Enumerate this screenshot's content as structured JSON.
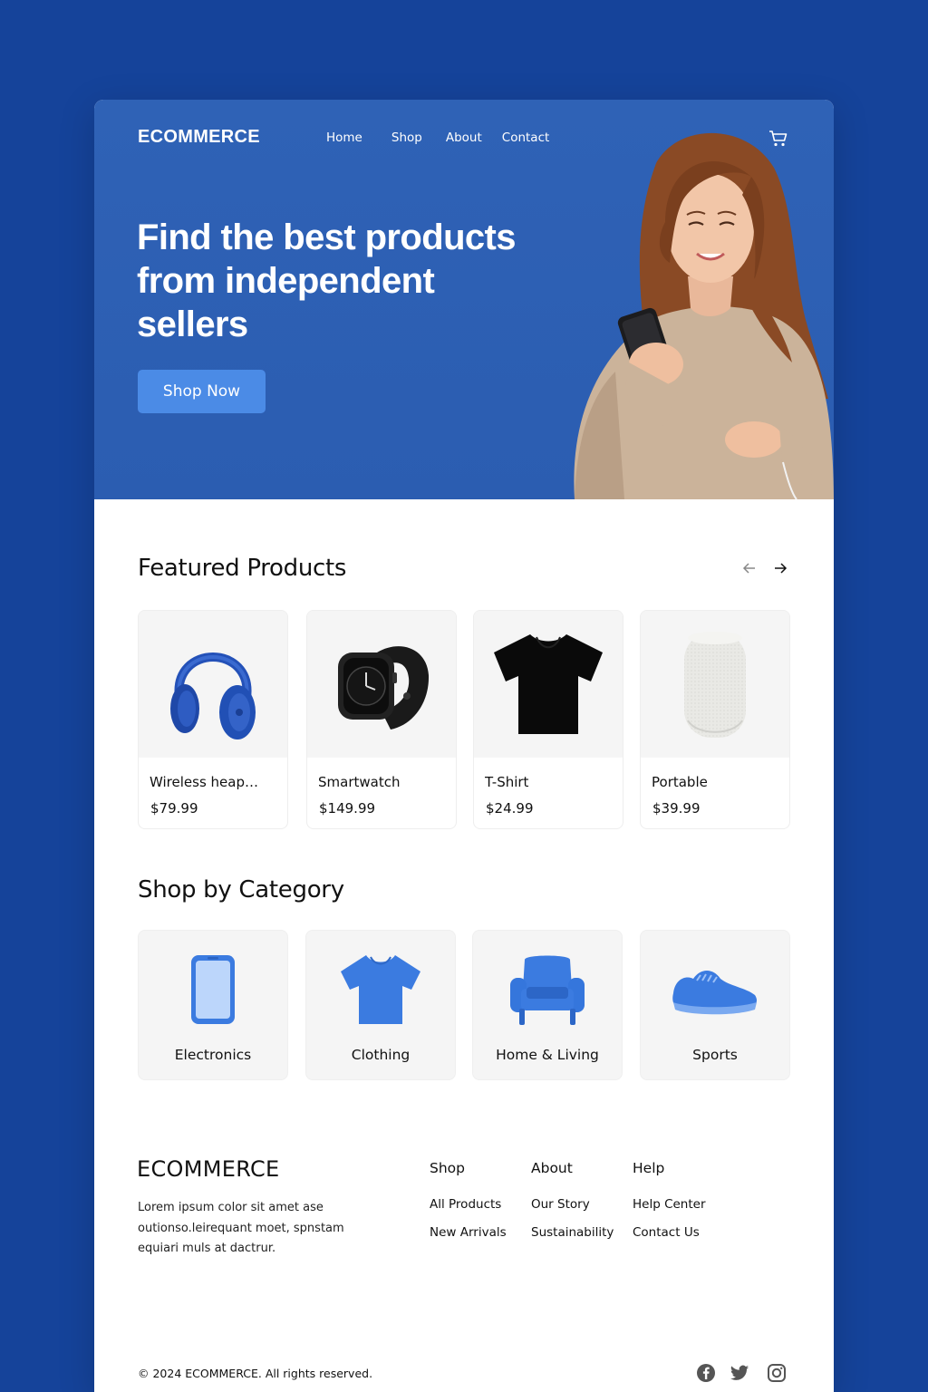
{
  "header": {
    "brand": "ECOMMERCE",
    "nav": [
      "Home",
      "Shop",
      "About",
      "Contact"
    ]
  },
  "hero": {
    "headline": "Find the best products from independent sellers",
    "cta": "Shop Now"
  },
  "featured": {
    "title": "Featured Products",
    "products": [
      {
        "name": "Wireless heapho...",
        "price": "$79.99",
        "icon": "headphones-image"
      },
      {
        "name": "Smartwatch",
        "price": "$149.99",
        "icon": "smartwatch-image"
      },
      {
        "name": "T-Shirt",
        "price": "$24.99",
        "icon": "tshirt-image"
      },
      {
        "name": "Portable",
        "price": "$39.99",
        "icon": "speaker-image"
      }
    ]
  },
  "categories": {
    "title": "Shop by Category",
    "items": [
      {
        "label": "Electronics",
        "icon": "phone-icon"
      },
      {
        "label": "Clothing",
        "icon": "shirt-icon"
      },
      {
        "label": "Home & Living",
        "icon": "armchair-icon"
      },
      {
        "label": "Sports",
        "icon": "sneaker-icon"
      }
    ]
  },
  "footer": {
    "brand": "ECOMMERCE",
    "text": "Lorem ipsum color sit amet ase outionso.leirequant moet, spnstam equiari muls at dactrur.",
    "columns": [
      {
        "heading": "Shop",
        "links": [
          "All Products",
          "New Arrivals"
        ]
      },
      {
        "heading": "About",
        "links": [
          "Our Story",
          "Sustainability"
        ]
      },
      {
        "heading": "Help",
        "links": [
          "Help Center",
          "Contact Us"
        ]
      }
    ],
    "copyright": "© 2024 ECOMMERCE. All rights reserved.",
    "social": [
      "facebook-icon",
      "twitter-icon",
      "instagram-icon"
    ]
  },
  "colors": {
    "page_bg": "#15439a",
    "hero_bg": "#2f62b6",
    "accent": "#4b8be6",
    "category_icon": "#3b7be0"
  }
}
